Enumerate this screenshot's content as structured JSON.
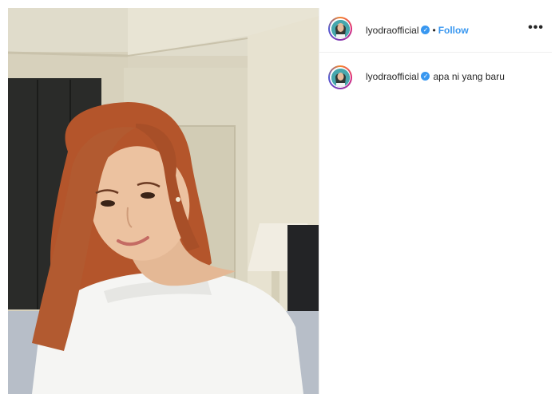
{
  "post": {
    "username": "lyodraofficial",
    "verified_label": "✓",
    "separator": "•",
    "follow_label": "Follow",
    "more_label": "•••"
  },
  "caption": {
    "username": "lyodraofficial",
    "verified_label": "✓",
    "text": "apa ni yang baru"
  },
  "colors": {
    "accent": "#3897f0",
    "text": "#262626",
    "border": "#efefef"
  },
  "icons": {
    "verified": "verified-badge-icon",
    "more": "more-options-icon"
  }
}
